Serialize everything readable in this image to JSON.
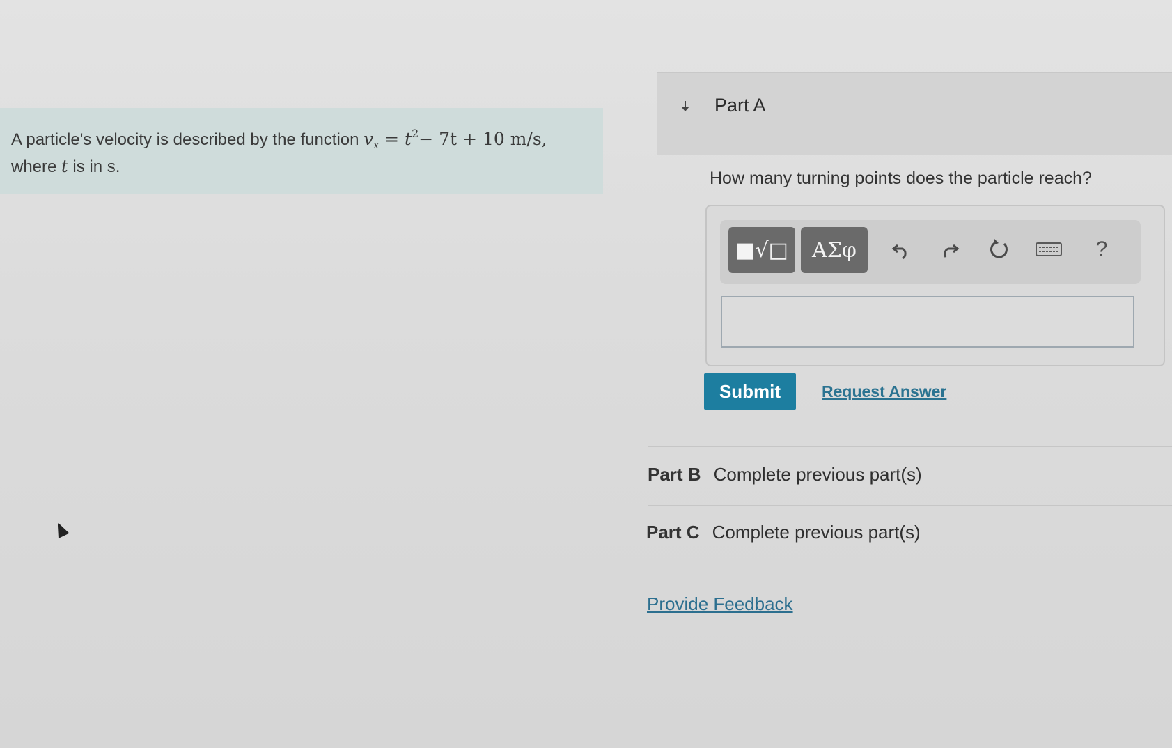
{
  "problem": {
    "text_before": "A particle's velocity is described by the function ",
    "math_v": "v",
    "math_sub": "x",
    "math_eq": " = ",
    "math_t": "t",
    "math_exp": "2",
    "math_rest": "− 7t + 10 m/s,",
    "line2_before": "where ",
    "line2_var": "t",
    "line2_after": " is in s."
  },
  "part_a": {
    "title": "Part A",
    "question": "How many turning points does the particle reach?",
    "toolbar": {
      "templates_label": "■√□",
      "symbols_label": "ΑΣφ",
      "undo_icon": "undo-icon",
      "redo_icon": "redo-icon",
      "reset_icon": "reset-icon",
      "keyboard_icon": "keyboard-icon",
      "help_label": "?"
    },
    "answer_value": "",
    "submit_label": "Submit",
    "request_answer_label": "Request Answer"
  },
  "part_b": {
    "name": "Part B",
    "status": "Complete previous part(s)"
  },
  "part_c": {
    "name": "Part C",
    "status": "Complete previous part(s)"
  },
  "feedback_label": "Provide Feedback",
  "colors": {
    "submit": "#1d7ea0",
    "link": "#2b7391",
    "problem_bg": "#cfdcdb"
  }
}
